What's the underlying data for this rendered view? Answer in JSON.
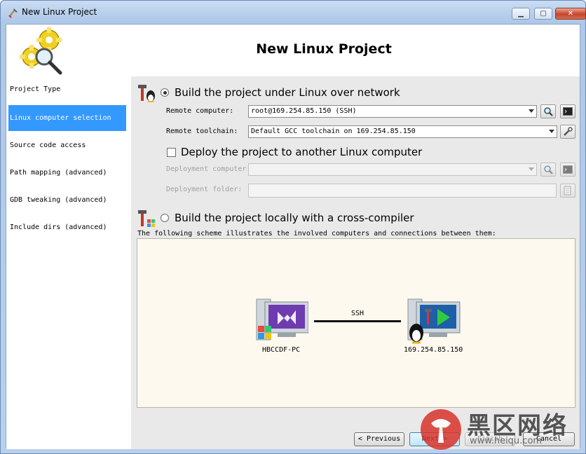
{
  "window": {
    "title": "New Linux Project"
  },
  "header": {
    "title": "New Linux Project"
  },
  "sidebar": {
    "items": [
      {
        "label": "Project Type"
      },
      {
        "label": "Linux computer selection"
      },
      {
        "label": "Source code access"
      },
      {
        "label": "Path mapping (advanced)"
      },
      {
        "label": "GDB tweaking (advanced)"
      },
      {
        "label": "Include dirs (advanced)"
      }
    ],
    "active_index": 1
  },
  "remote": {
    "option_label": "Build the project under Linux over network",
    "computer_label": "Remote computer:",
    "computer_value": "root@169.254.85.150 (SSH)",
    "toolchain_label": "Remote toolchain:",
    "toolchain_value": "Default GCC toolchain on 169.254.85.150"
  },
  "deploy": {
    "option_label": "Deploy the project to another Linux computer",
    "computer_label": "Deployment computer:",
    "folder_label": "Deployment folder:"
  },
  "cross": {
    "option_label": "Build the project locally with a cross-compiler"
  },
  "scheme": {
    "caption": "The following scheme illustrates the involved computers and connections between them:",
    "left_name": "HBCCDF-PC",
    "link_label": "SSH",
    "right_name": "169.254.85.150"
  },
  "buttons": {
    "previous": "Previous",
    "next": "Next",
    "finish": "Finish",
    "cancel": "Cancel"
  },
  "icons": [
    "app-icon",
    "gears-logo-icon",
    "build-tools-icon",
    "search-icon",
    "terminal-icon",
    "wrench-icon",
    "folder-icon",
    "windows-pc-icon",
    "linux-pc-icon"
  ],
  "watermark": {
    "text": "黑区网络",
    "url": "www.heiqu.com"
  },
  "colors": {
    "accent": "#3399ff",
    "scheme_bg": "#fdf9ef",
    "panel_bg": "#e9e9e9"
  }
}
